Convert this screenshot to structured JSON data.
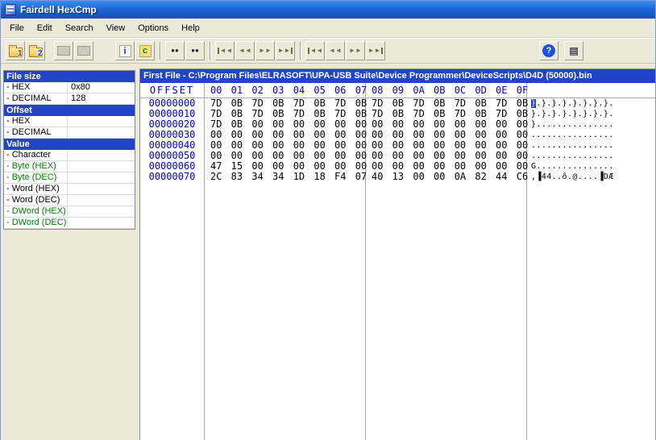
{
  "window": {
    "title": "Fairdell HexCmp"
  },
  "colors": {
    "accent_blue": "#2444c8",
    "offset_blue": "#0000cd",
    "label_green": "#008000",
    "titlebar_blue": "#1e63d0",
    "toolbar_gray": "#ece9d8"
  },
  "menu": {
    "items": [
      "File",
      "Edit",
      "Search",
      "View",
      "Options",
      "Help"
    ]
  },
  "toolbar": {
    "buttons": [
      {
        "type": "folder",
        "name": "open-first-file-button",
        "icon": "open-file-1-icon",
        "badge": "1",
        "badge_color": "#cc1100"
      },
      {
        "type": "folder",
        "name": "open-second-file-button",
        "icon": "open-file-2-icon",
        "badge": "2",
        "badge_color": "#1133cc"
      },
      {
        "type": "gap",
        "w": 10
      },
      {
        "type": "disabled",
        "name": "compare-files-button",
        "icon": "compare-files-icon"
      },
      {
        "type": "disabled",
        "name": "resume-compare-button",
        "icon": "resume-compare-icon"
      },
      {
        "type": "gap",
        "w": 26
      },
      {
        "type": "glyph",
        "name": "file-info-button",
        "icon": "info-icon",
        "glyph": "i",
        "color": "#1a3fd0",
        "bg": "#fdfdfd",
        "fs": 12
      },
      {
        "type": "glyph",
        "name": "color-scheme-button",
        "icon": "colors-icon",
        "glyph": "c",
        "color": "#0b7d32",
        "bg": "#ffe36a",
        "fs": 11
      },
      {
        "type": "sep"
      },
      {
        "type": "glyph",
        "name": "find-button",
        "icon": "binoculars-icon",
        "glyph": "●●",
        "color": "#1a1a1a",
        "fs": 8
      },
      {
        "type": "glyph",
        "name": "find-next-button",
        "icon": "binoculars-next-icon",
        "glyph": "●●",
        "color": "#1a1a1a",
        "fs": 8
      },
      {
        "type": "sep"
      },
      {
        "type": "glyph",
        "name": "first-difference-button",
        "icon": "first-difference-icon",
        "glyph": "◄◄",
        "color": "#6d6d3b",
        "fs": 8,
        "bar": "left"
      },
      {
        "type": "glyph",
        "name": "previous-difference-button",
        "icon": "previous-difference-icon",
        "glyph": "◄◄",
        "color": "#6d6d3b",
        "fs": 8
      },
      {
        "type": "glyph",
        "name": "next-difference-button",
        "icon": "next-difference-icon",
        "glyph": "►►",
        "color": "#6d6d3b",
        "fs": 8
      },
      {
        "type": "glyph",
        "name": "last-difference-button",
        "icon": "last-difference-icon",
        "glyph": "►►",
        "color": "#6d6d3b",
        "fs": 8,
        "bar": "right"
      },
      {
        "type": "sep"
      },
      {
        "type": "glyph",
        "name": "first-match-button",
        "icon": "first-match-icon",
        "glyph": "◄◄",
        "color": "#6d6d3b",
        "fs": 8,
        "bar": "left"
      },
      {
        "type": "glyph",
        "name": "previous-match-button",
        "icon": "previous-match-icon",
        "glyph": "◄◄",
        "color": "#6d6d3b",
        "fs": 8
      },
      {
        "type": "glyph",
        "name": "next-match-button",
        "icon": "next-match-icon",
        "glyph": "►►",
        "color": "#6d6d3b",
        "fs": 8
      },
      {
        "type": "glyph",
        "name": "last-match-button",
        "icon": "last-match-icon",
        "glyph": "►►",
        "color": "#6d6d3b",
        "fs": 8,
        "bar": "right"
      },
      {
        "type": "gap",
        "w": 190
      },
      {
        "type": "glyph",
        "name": "help-button",
        "icon": "help-icon",
        "glyph": "?",
        "color": "#ffffff",
        "bg": "#1e50d8",
        "fs": 11,
        "round": true
      },
      {
        "type": "gap",
        "w": 6
      },
      {
        "type": "glyph",
        "name": "report-button",
        "icon": "report-icon",
        "glyph": "▤",
        "color": "#444455",
        "fs": 12
      }
    ]
  },
  "info_panel": {
    "rows": [
      {
        "type": "header",
        "label": "File size"
      },
      {
        "type": "data",
        "label": "- HEX",
        "value": "0x80",
        "color": "black"
      },
      {
        "type": "data",
        "label": "- DECIMAL",
        "value": "128",
        "color": "black"
      },
      {
        "type": "header",
        "label": "Offset"
      },
      {
        "type": "data",
        "label": "- HEX",
        "value": "",
        "color": "black"
      },
      {
        "type": "data",
        "label": "- DECIMAL",
        "value": "",
        "color": "black"
      },
      {
        "type": "header",
        "label": "Value"
      },
      {
        "type": "data",
        "label": "- Character",
        "value": "",
        "color": "black"
      },
      {
        "type": "data",
        "label": "- Byte (HEX)",
        "value": "",
        "color": "green"
      },
      {
        "type": "data",
        "label": "- Byte (DEC)",
        "value": "",
        "color": "green"
      },
      {
        "type": "data",
        "label": "- Word (HEX)",
        "value": "",
        "color": "black"
      },
      {
        "type": "data",
        "label": "- Word (DEC)",
        "value": "",
        "color": "black"
      },
      {
        "type": "data",
        "label": "- DWord (HEX)",
        "value": "",
        "color": "green"
      },
      {
        "type": "data",
        "label": "- DWord (DEC)",
        "value": "",
        "color": "green"
      }
    ]
  },
  "hex_view": {
    "title": "First File - C:\\Program Files\\ELRASOFT\\UPA-USB Suite\\Device Programmer\\DeviceScripts\\D4D (50000).bin",
    "offset_header": "OFFSET",
    "col_headers_left": [
      "00",
      "01",
      "02",
      "03",
      "04",
      "05",
      "06",
      "07"
    ],
    "col_headers_right": [
      "08",
      "09",
      "0A",
      "0B",
      "0C",
      "0D",
      "0E",
      "0F"
    ],
    "cursor": {
      "row": 0,
      "col": 0
    },
    "rows": [
      {
        "offset": "00000000",
        "hex_left": "7D 0B 7D 0B 7D 0B 7D 0B",
        "hex_right": "7D 0B 7D 0B 7D 0B 7D 0B",
        "ascii": "}.}.}.}.}.}.}.}."
      },
      {
        "offset": "00000010",
        "hex_left": "7D 0B 7D 0B 7D 0B 7D 0B",
        "hex_right": "7D 0B 7D 0B 7D 0B 7D 0B",
        "ascii": "}.}.}.}.}.}.}.}."
      },
      {
        "offset": "00000020",
        "hex_left": "7D 0B 00 00 00 00 00 00",
        "hex_right": "00 00 00 00 00 00 00 00",
        "ascii": "}..............."
      },
      {
        "offset": "00000030",
        "hex_left": "00 00 00 00 00 00 00 00",
        "hex_right": "00 00 00 00 00 00 00 00",
        "ascii": "................"
      },
      {
        "offset": "00000040",
        "hex_left": "00 00 00 00 00 00 00 00",
        "hex_right": "00 00 00 00 00 00 00 00",
        "ascii": "................"
      },
      {
        "offset": "00000050",
        "hex_left": "00 00 00 00 00 00 00 00",
        "hex_right": "00 00 00 00 00 00 00 00",
        "ascii": "................"
      },
      {
        "offset": "00000060",
        "hex_left": "47 15 00 00 00 00 00 00",
        "hex_right": "00 00 00 00 00 00 00 00",
        "ascii": "G..............."
      },
      {
        "offset": "00000070",
        "hex_left": "2C 83 34 34 1D 18 F4 07",
        "hex_right": "40 13 00 00 0A 82 44 C6",
        "ascii": ",▐44..ô.@....▐DÆ"
      }
    ]
  }
}
